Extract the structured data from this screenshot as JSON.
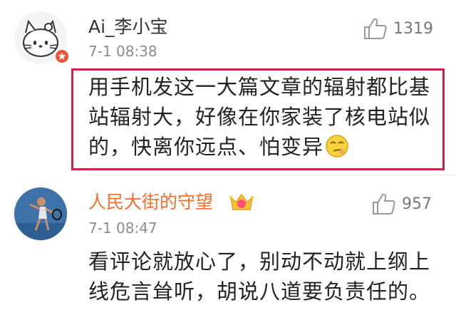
{
  "comments": [
    {
      "username": "Ai_李小宝",
      "time": "7-1 08:38",
      "likes": "1319",
      "text": "用手机发这一大篇文章的辐射都比基站辐射大，好像在你家装了核电站似的，快离你远点、怕变异",
      "emoji": "smirk-emoji",
      "avatar_badge_color": "#f0523a"
    },
    {
      "username": "人民大街的守望",
      "time": "7-1 08:47",
      "likes": "957",
      "text": "看评论就放心了，别动不动就上纲上线危言耸听，胡说八道要负责任的。",
      "username_color": "#f36f2c",
      "badge": "crown-icon"
    }
  ],
  "colors": {
    "highlight_border": "#c8234a",
    "time": "#8c8c8c",
    "like": "#777777"
  }
}
